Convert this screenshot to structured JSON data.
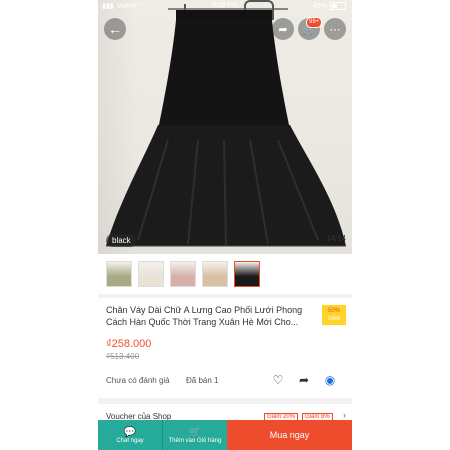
{
  "status": {
    "carrier": "Viettel",
    "time": "3:08 PM",
    "battery": "45%"
  },
  "gallery": {
    "variant": "black",
    "counter": "14/14",
    "cart_count": "99+"
  },
  "thumbnails": [
    {
      "color": "#a8aa84",
      "active": false
    },
    {
      "color": "#e9e3d6",
      "active": false
    },
    {
      "color": "#d7b1a9",
      "active": false
    },
    {
      "color": "#d9c0a3",
      "active": false
    },
    {
      "color": "#1a1a1a",
      "active": true
    }
  ],
  "product": {
    "title": "Chân Váy Dài Chữ A Lưng Cao Phối Lưới Phong Cách Hàn Quốc Thời Trang Xuân Hè Mới Cho...",
    "discount": "50%",
    "discount_label": "GIẢM",
    "price": "₫258.000",
    "old_price": "₫513.400",
    "rating": "Chưa có đánh giá",
    "sold": "Đã bán 1"
  },
  "voucher": {
    "label": "Voucher của Shop",
    "tags": [
      "Giảm 20%",
      "Giảm 8%"
    ]
  },
  "bottom": {
    "chat": "Chat ngay",
    "cart": "Thêm vào Giỏ hàng",
    "buy": "Mua ngay"
  }
}
